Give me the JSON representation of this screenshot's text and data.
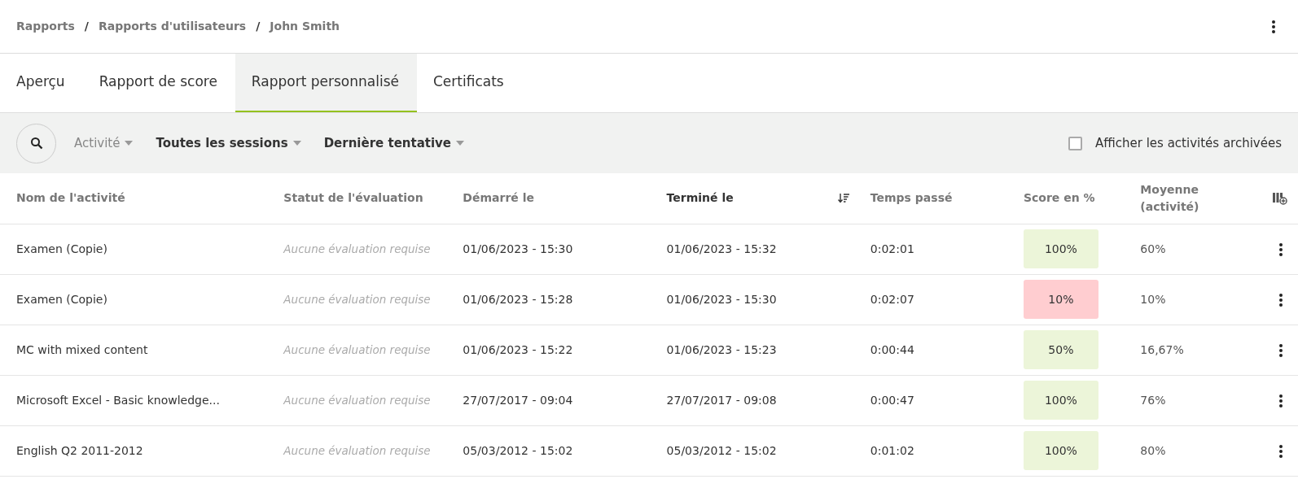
{
  "breadcrumb": [
    "Rapports",
    "Rapports d'utilisateurs",
    "John Smith"
  ],
  "separator": "/",
  "tabs": [
    {
      "label": "Aperçu",
      "selected": false
    },
    {
      "label": "Rapport de score",
      "selected": false
    },
    {
      "label": "Rapport personnalisé",
      "selected": true
    },
    {
      "label": "Certificats",
      "selected": false
    }
  ],
  "filters": [
    {
      "label": "Activité",
      "active": false
    },
    {
      "label": "Toutes les sessions",
      "active": true
    },
    {
      "label": "Dernière tentative",
      "active": true
    }
  ],
  "archived_toggle": {
    "label": "Afficher les activités archivées",
    "checked": false
  },
  "table": {
    "columns": [
      {
        "label": "Nom de l'activité",
        "sorted": false
      },
      {
        "label": "Statut de l'évaluation",
        "sorted": false
      },
      {
        "label": "Démarré le",
        "sorted": false
      },
      {
        "label": "Terminé le",
        "sorted": true
      },
      {
        "label": "Temps passé",
        "sorted": false
      },
      {
        "label": "Score en %",
        "sorted": false
      },
      {
        "label": "Moyenne (activité)",
        "sorted": false
      }
    ],
    "rows": [
      {
        "name": "Examen (Copie)",
        "evaluation": "Aucune évaluation requise",
        "started": "01/06/2023 - 15:30",
        "finished": "01/06/2023 - 15:32",
        "time": "0:02:01",
        "score": "100%",
        "passed": true,
        "average": "60%"
      },
      {
        "name": "Examen (Copie)",
        "evaluation": "Aucune évaluation requise",
        "started": "01/06/2023 - 15:28",
        "finished": "01/06/2023 - 15:30",
        "time": "0:02:07",
        "score": "10%",
        "passed": false,
        "average": "10%"
      },
      {
        "name": "MC with mixed content",
        "evaluation": "Aucune évaluation requise",
        "started": "01/06/2023 - 15:22",
        "finished": "01/06/2023 - 15:23",
        "time": "0:00:44",
        "score": "50%",
        "passed": true,
        "average": "16,67%"
      },
      {
        "name": "Microsoft Excel - Basic knowledge...",
        "evaluation": "Aucune évaluation requise",
        "started": "27/07/2017 - 09:04",
        "finished": "27/07/2017 - 09:08",
        "time": "0:00:47",
        "score": "100%",
        "passed": true,
        "average": "76%"
      },
      {
        "name": "English Q2 2011-2012",
        "evaluation": "Aucune évaluation requise",
        "started": "05/03/2012 - 15:02",
        "finished": "05/03/2012 - 15:02",
        "time": "0:01:02",
        "score": "100%",
        "passed": true,
        "average": "80%"
      }
    ]
  }
}
